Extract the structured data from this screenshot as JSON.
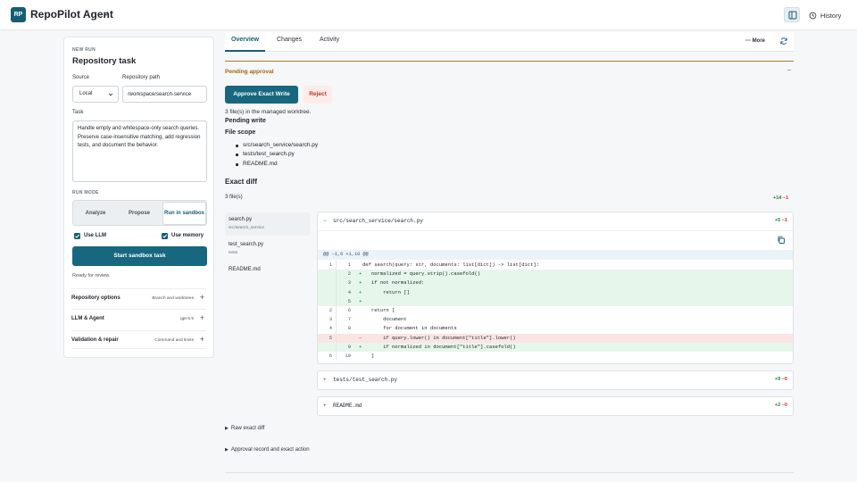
{
  "app": {
    "logo_text": "RP",
    "title": "RepoPilot Agent",
    "history_label": "History"
  },
  "left_panel": {
    "eyebrow": "NEW RUN",
    "title": "Repository task",
    "source_label": "Source",
    "source_value": "Local",
    "repo_path_label": "Repository path",
    "repo_path_value": "/workspace/search-service",
    "task_label": "Task",
    "task_value": "Handle empty and whitespace-only search queries.\nPreserve case-insensitive matching, add regression tests, and document the behavior.",
    "run_mode_label": "RUN MODE",
    "modes": [
      {
        "label": "Analyze",
        "active": false
      },
      {
        "label": "Propose",
        "active": false
      },
      {
        "label": "Run in sandbox",
        "active": true
      }
    ],
    "use_llm_label": "Use LLM",
    "use_memory_label": "Use memory",
    "start_label": "Start sandbox task",
    "status": "Ready for review.",
    "sections": [
      {
        "title": "Repository options",
        "meta": "Branch and worktrees"
      },
      {
        "title": "LLM & Agent",
        "meta": "gpt-5.5"
      },
      {
        "title": "Validation & repair",
        "meta": "Command and limits"
      }
    ]
  },
  "main": {
    "tabs": [
      "Overview",
      "Changes",
      "Activity"
    ],
    "active_tab": "Overview",
    "more_label": "More",
    "pending_title": "Pending approval",
    "approve_label": "Approve Exact Write",
    "reject_label": "Reject",
    "managed_note": "3 file(s) in the managed worktree.",
    "pending_write": "Pending write",
    "file_scope_title": "File scope",
    "file_scope": [
      "src/search_service/search.py",
      "tests/test_search.py",
      "README.md"
    ],
    "exact_diff_title": "Exact diff",
    "files_count": "3 file(s)",
    "total_added": "+14",
    "total_removed": "−1",
    "file_nav": [
      {
        "name": "search.py",
        "dir": "src/search_service",
        "active": true
      },
      {
        "name": "test_search.py",
        "dir": "tests",
        "active": false
      },
      {
        "name": "README.md",
        "dir": "",
        "active": false
      }
    ],
    "diffs": [
      {
        "sign": "−",
        "path": "src/search_service/search.py",
        "added": "+5",
        "removed": "−1",
        "expanded": true,
        "hunk": "@@ −1,6 +1,10 @@",
        "lines": [
          {
            "old": "1",
            "new": "1",
            "type": "ctx",
            "mark": "",
            "code": "def search(query: str, documents: list[dict]) -> list[dict]:"
          },
          {
            "old": "",
            "new": "2",
            "type": "add",
            "mark": "+",
            "code": "   normalized = query.strip().casefold()"
          },
          {
            "old": "",
            "new": "3",
            "type": "add",
            "mark": "+",
            "code": "   if not normalized:"
          },
          {
            "old": "",
            "new": "4",
            "type": "add",
            "mark": "+",
            "code": "       return []"
          },
          {
            "old": "",
            "new": "5",
            "type": "add",
            "mark": "+",
            "code": ""
          },
          {
            "old": "2",
            "new": "6",
            "type": "ctx",
            "mark": "",
            "code": "   return ["
          },
          {
            "old": "3",
            "new": "7",
            "type": "ctx",
            "mark": "",
            "code": "       document"
          },
          {
            "old": "4",
            "new": "8",
            "type": "ctx",
            "mark": "",
            "code": "       for document in documents"
          },
          {
            "old": "5",
            "new": "",
            "type": "del",
            "mark": "−",
            "code": "       if query.lower() in document[\"title\"].lower()"
          },
          {
            "old": "",
            "new": "9",
            "type": "add",
            "mark": "+",
            "code": "       if normalized in document[\"title\"].casefold()"
          },
          {
            "old": "6",
            "new": "10",
            "type": "ctx",
            "mark": "",
            "code": "   ]"
          }
        ]
      },
      {
        "sign": "+",
        "path": "tests/test_search.py",
        "added": "+9",
        "removed": "−0",
        "expanded": false
      },
      {
        "sign": "+",
        "path": "README.md",
        "added": "+2",
        "removed": "−0",
        "expanded": false
      }
    ],
    "raw_diff_label": "Raw exact diff",
    "approval_record_label": "Approval record and exact action"
  },
  "colors": {
    "accent": "#155e75",
    "add_bg": "#e6f6ea",
    "del_bg": "#fbe4e4",
    "pending": "#a0661a",
    "reject": "#c0322b"
  }
}
